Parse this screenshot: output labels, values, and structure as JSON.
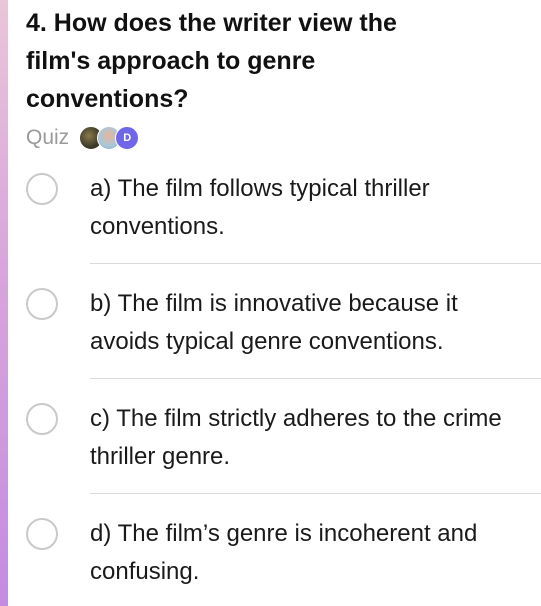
{
  "question": {
    "title": "4. How does the writer view the film's approach to genre conventions?"
  },
  "meta": {
    "label": "Quiz",
    "avatars": [
      "photo-avatar",
      "photo-avatar",
      "D"
    ]
  },
  "options": [
    {
      "text": "a) The film follows typical thriller conventions."
    },
    {
      "text": "b) The film is innovative because it avoids typical genre conventions."
    },
    {
      "text": "c) The film strictly adheres to the crime thriller genre."
    },
    {
      "text": "d) The film’s genre is incoherent and confusing."
    }
  ],
  "colors": {
    "accent_strip": "#c58be0",
    "avatar_badge": "#6f66e8",
    "radio_border": "#c9c9c9"
  }
}
